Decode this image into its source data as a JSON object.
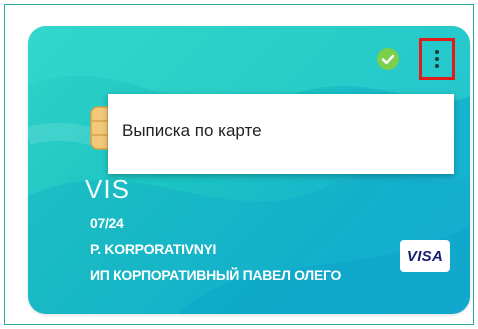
{
  "card": {
    "brand_text": "VIS",
    "expiry": "07/24",
    "holder_name": "P. KORPORATIVNYI",
    "company_name": "ИП КОРПОРАТИВНЫЙ ПАВЕЛ ОЛЕГО",
    "logo_text": "VISA",
    "status_icon": "check-circle-icon",
    "gradient_colors": [
      "#2fd3c8",
      "#15b3cf"
    ]
  },
  "menu_button": {
    "icon": "more-vertical-icon",
    "highlight_color": "#e11a1a"
  },
  "dropdown": {
    "items": [
      {
        "label": "Выписка по карте"
      }
    ]
  }
}
